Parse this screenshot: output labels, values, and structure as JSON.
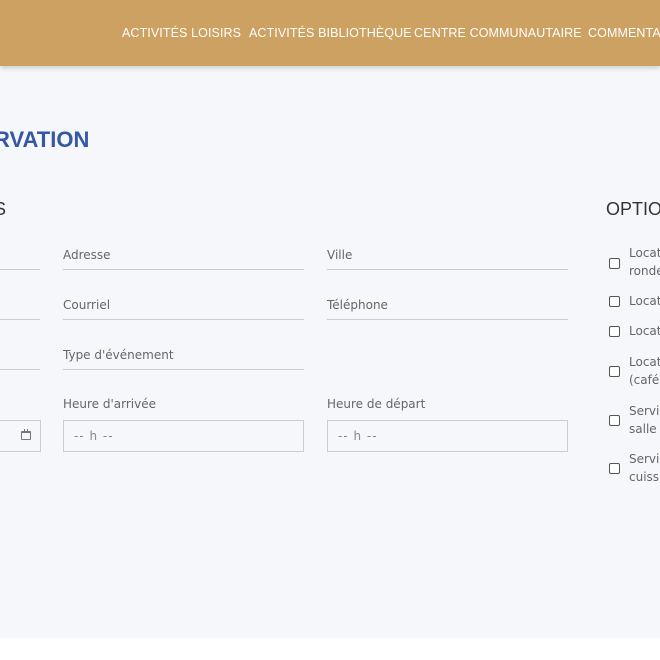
{
  "nav": {
    "items": [
      "ACTIVITÉS LOISIRS",
      "ACTIVITÉS BIBLIOTHÈQUE",
      "CENTRE COMMUNAUTAIRE",
      "COMMENTAI"
    ]
  },
  "page": {
    "title": "RVATION",
    "section_left": "S",
    "section_right": "OPTIO"
  },
  "form": {
    "adresse": "Adresse",
    "ville": "Ville",
    "courriel": "Courriel",
    "telephone": "Téléphone",
    "type_evenement": "Type d'événement",
    "heure_arrivee": "Heure d'arrivée",
    "heure_depart": "Heure de départ",
    "time_placeholder": "-- h --"
  },
  "options": [
    {
      "line1": "Locat",
      "line2": "ronde"
    },
    {
      "line1": "Locat",
      "line2": ""
    },
    {
      "line1": "Locat",
      "line2": ""
    },
    {
      "line1": "Locat",
      "line2": "(café"
    },
    {
      "line1": "Servi",
      "line2": "salle"
    },
    {
      "line1": "Servi",
      "line2": "cuiss"
    }
  ],
  "colors": {
    "topbar": "#cda162",
    "title": "#3557a5",
    "background": "#f5f7fb"
  }
}
